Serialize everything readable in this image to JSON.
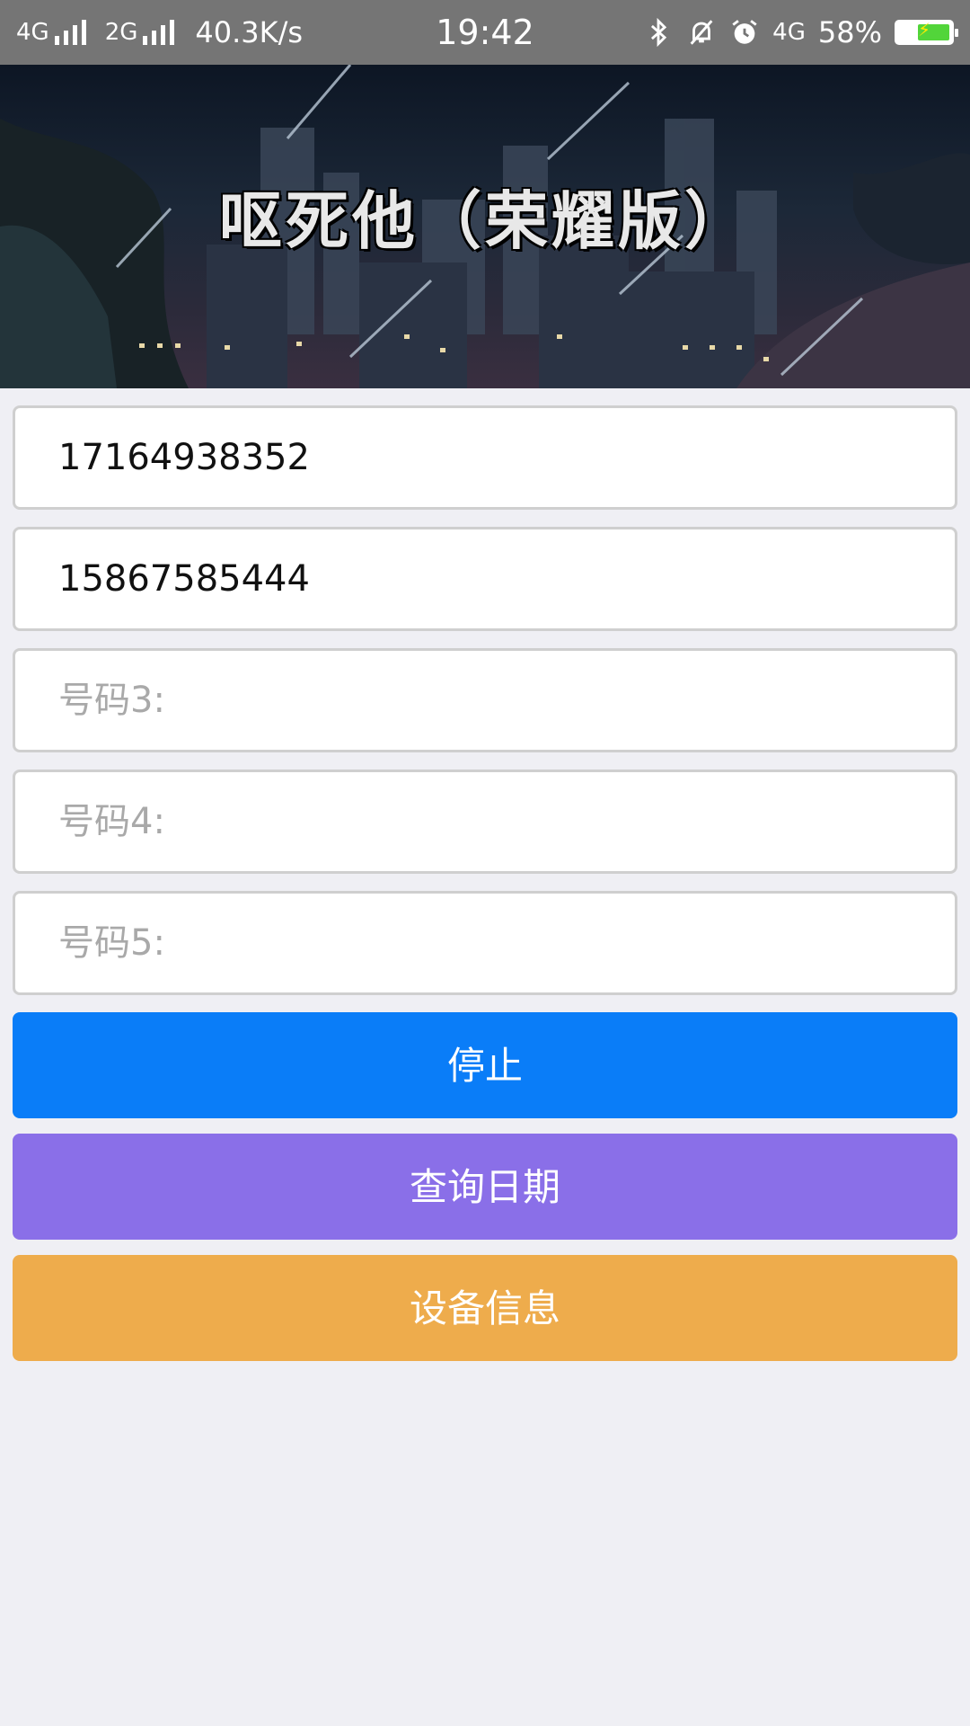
{
  "status_bar": {
    "network_1": "4G",
    "network_2": "2G",
    "net_speed": "40.3K/s",
    "time": "19:42",
    "lte": "4G",
    "battery_percent": "58%",
    "battery_level": 0.58,
    "icons": [
      "bluetooth-icon",
      "muted-bell-icon",
      "alarm-clock-icon",
      "battery-charging-icon"
    ]
  },
  "banner": {
    "title": "呕死他（荣耀版）"
  },
  "form": {
    "fields": [
      {
        "value": "17164938352",
        "placeholder": ""
      },
      {
        "value": "15867585444",
        "placeholder": ""
      },
      {
        "value": "",
        "placeholder": "号码3:"
      },
      {
        "value": "",
        "placeholder": "号码4:"
      },
      {
        "value": "",
        "placeholder": "号码5:"
      }
    ]
  },
  "buttons": {
    "stop": {
      "label": "停止",
      "color": "#0a7df8"
    },
    "query_date": {
      "label": "查询日期",
      "color": "#8a6fe8"
    },
    "device_info": {
      "label": "设备信息",
      "color": "#eeac4c"
    }
  }
}
